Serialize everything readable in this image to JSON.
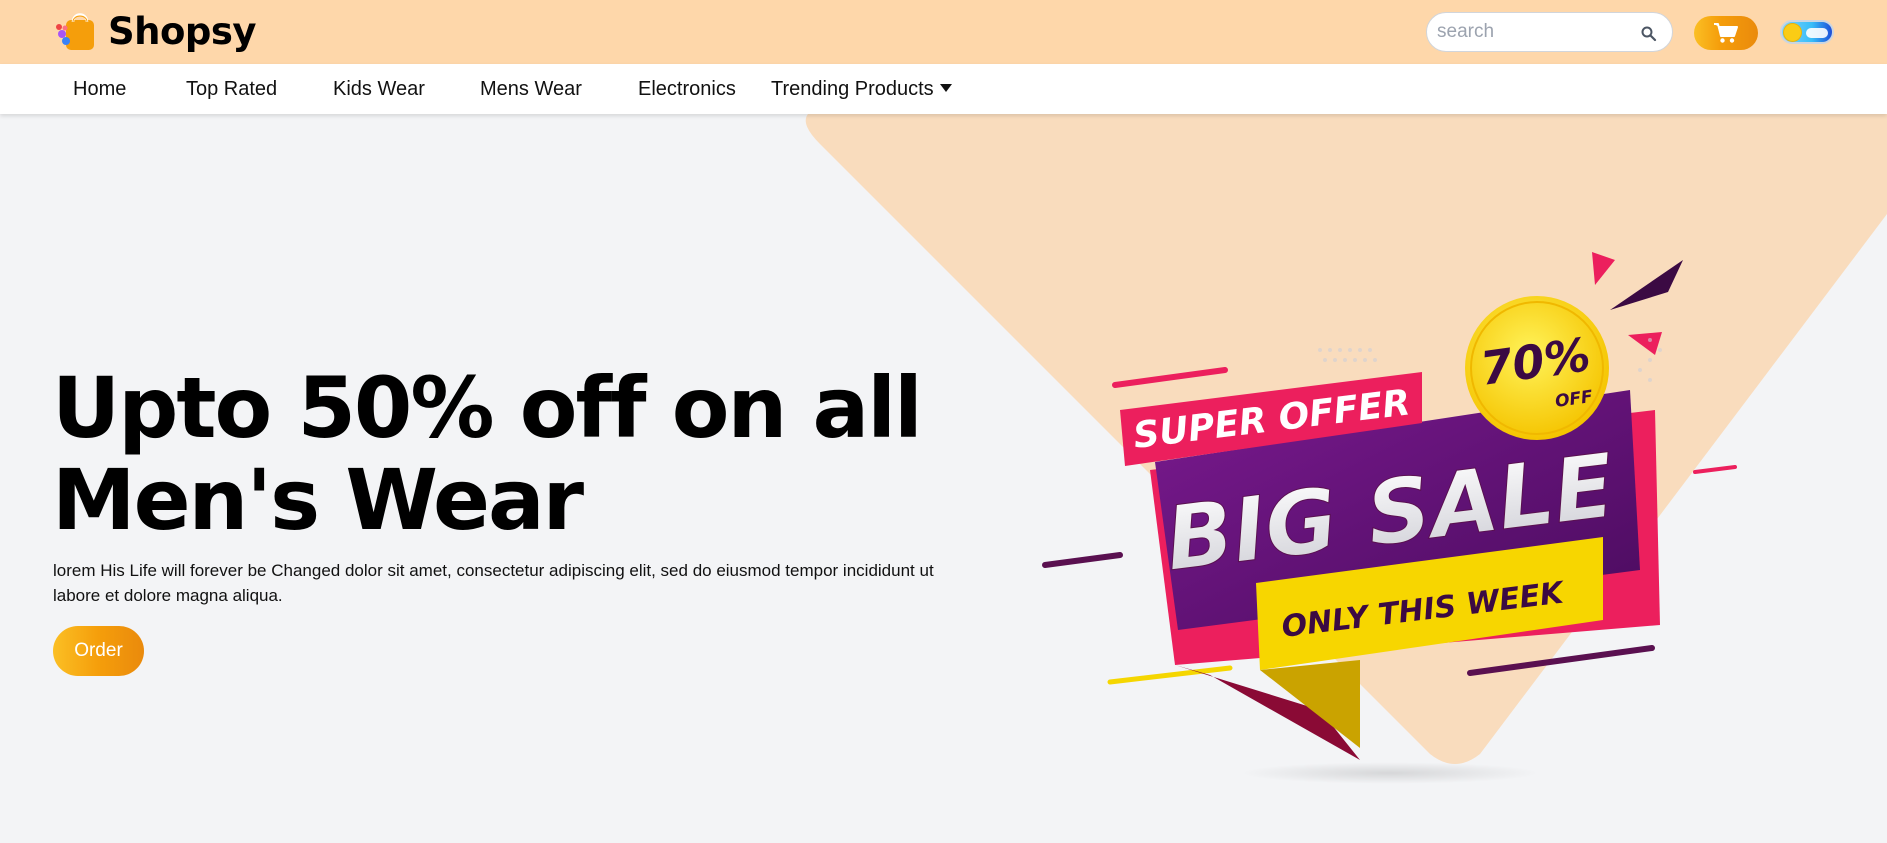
{
  "header": {
    "brand": "Shopsy",
    "search": {
      "placeholder": "search",
      "value": ""
    },
    "colors": {
      "bar": "#fed7aa",
      "accent": "#f59e0b"
    }
  },
  "nav": {
    "items": [
      {
        "label": "Home"
      },
      {
        "label": "Top Rated"
      },
      {
        "label": "Kids Wear"
      },
      {
        "label": "Mens Wear"
      },
      {
        "label": "Electronics"
      },
      {
        "label": "Trending Products"
      }
    ]
  },
  "hero": {
    "title_line1": "Upto 50% off on all",
    "title_line2": "Men's Wear",
    "description": "lorem His Life will forever be Changed dolor sit amet, consectetur adipiscing elit, sed do eiusmod tempor incididunt ut labore et dolore magna aliqua.",
    "order_label": "Order"
  },
  "banner": {
    "super_offer": "SUPER OFFER",
    "percent": "70%",
    "off": "OFF",
    "big_sale": "BIG SALE",
    "only_this_week": "ONLY THIS WEEK"
  }
}
